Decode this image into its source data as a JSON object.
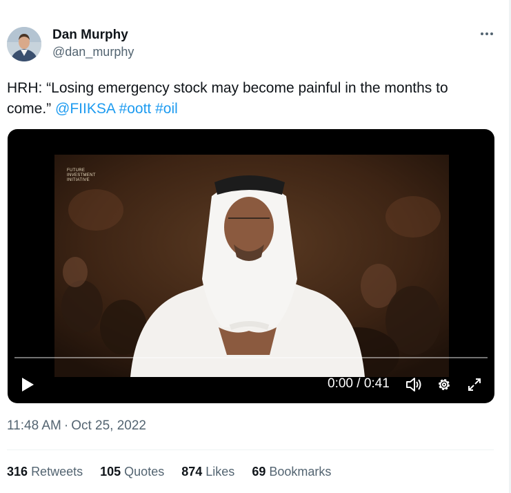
{
  "author": {
    "name": "Dan Murphy",
    "handle": "@dan_murphy"
  },
  "tweet": {
    "text": "HRH: “Losing emergency stock may become painful in the months to come.” ",
    "mention": "@FIIKSA",
    "hashtag1": "#oott",
    "hashtag2": "#oil"
  },
  "video": {
    "time": "0:00 / 0:41",
    "overlay_logo": "FUTURE INVESTMENT INITIATIVE",
    "progress": 0.0
  },
  "meta": {
    "time": "11:48 AM",
    "separator": "·",
    "date": "Oct 25, 2022"
  },
  "stats": {
    "retweets_count": "316",
    "retweets_label": "Retweets",
    "quotes_count": "105",
    "quotes_label": "Quotes",
    "likes_count": "874",
    "likes_label": "Likes",
    "bookmarks_count": "69",
    "bookmarks_label": "Bookmarks"
  },
  "icons": {
    "more": "more-horizontal-icon",
    "play": "play-icon",
    "volume": "volume-icon",
    "settings": "gear-icon",
    "fullscreen": "expand-icon"
  },
  "colors": {
    "link": "#1d9bf0",
    "secondary_text": "#536471",
    "primary_text": "#0f1419"
  }
}
